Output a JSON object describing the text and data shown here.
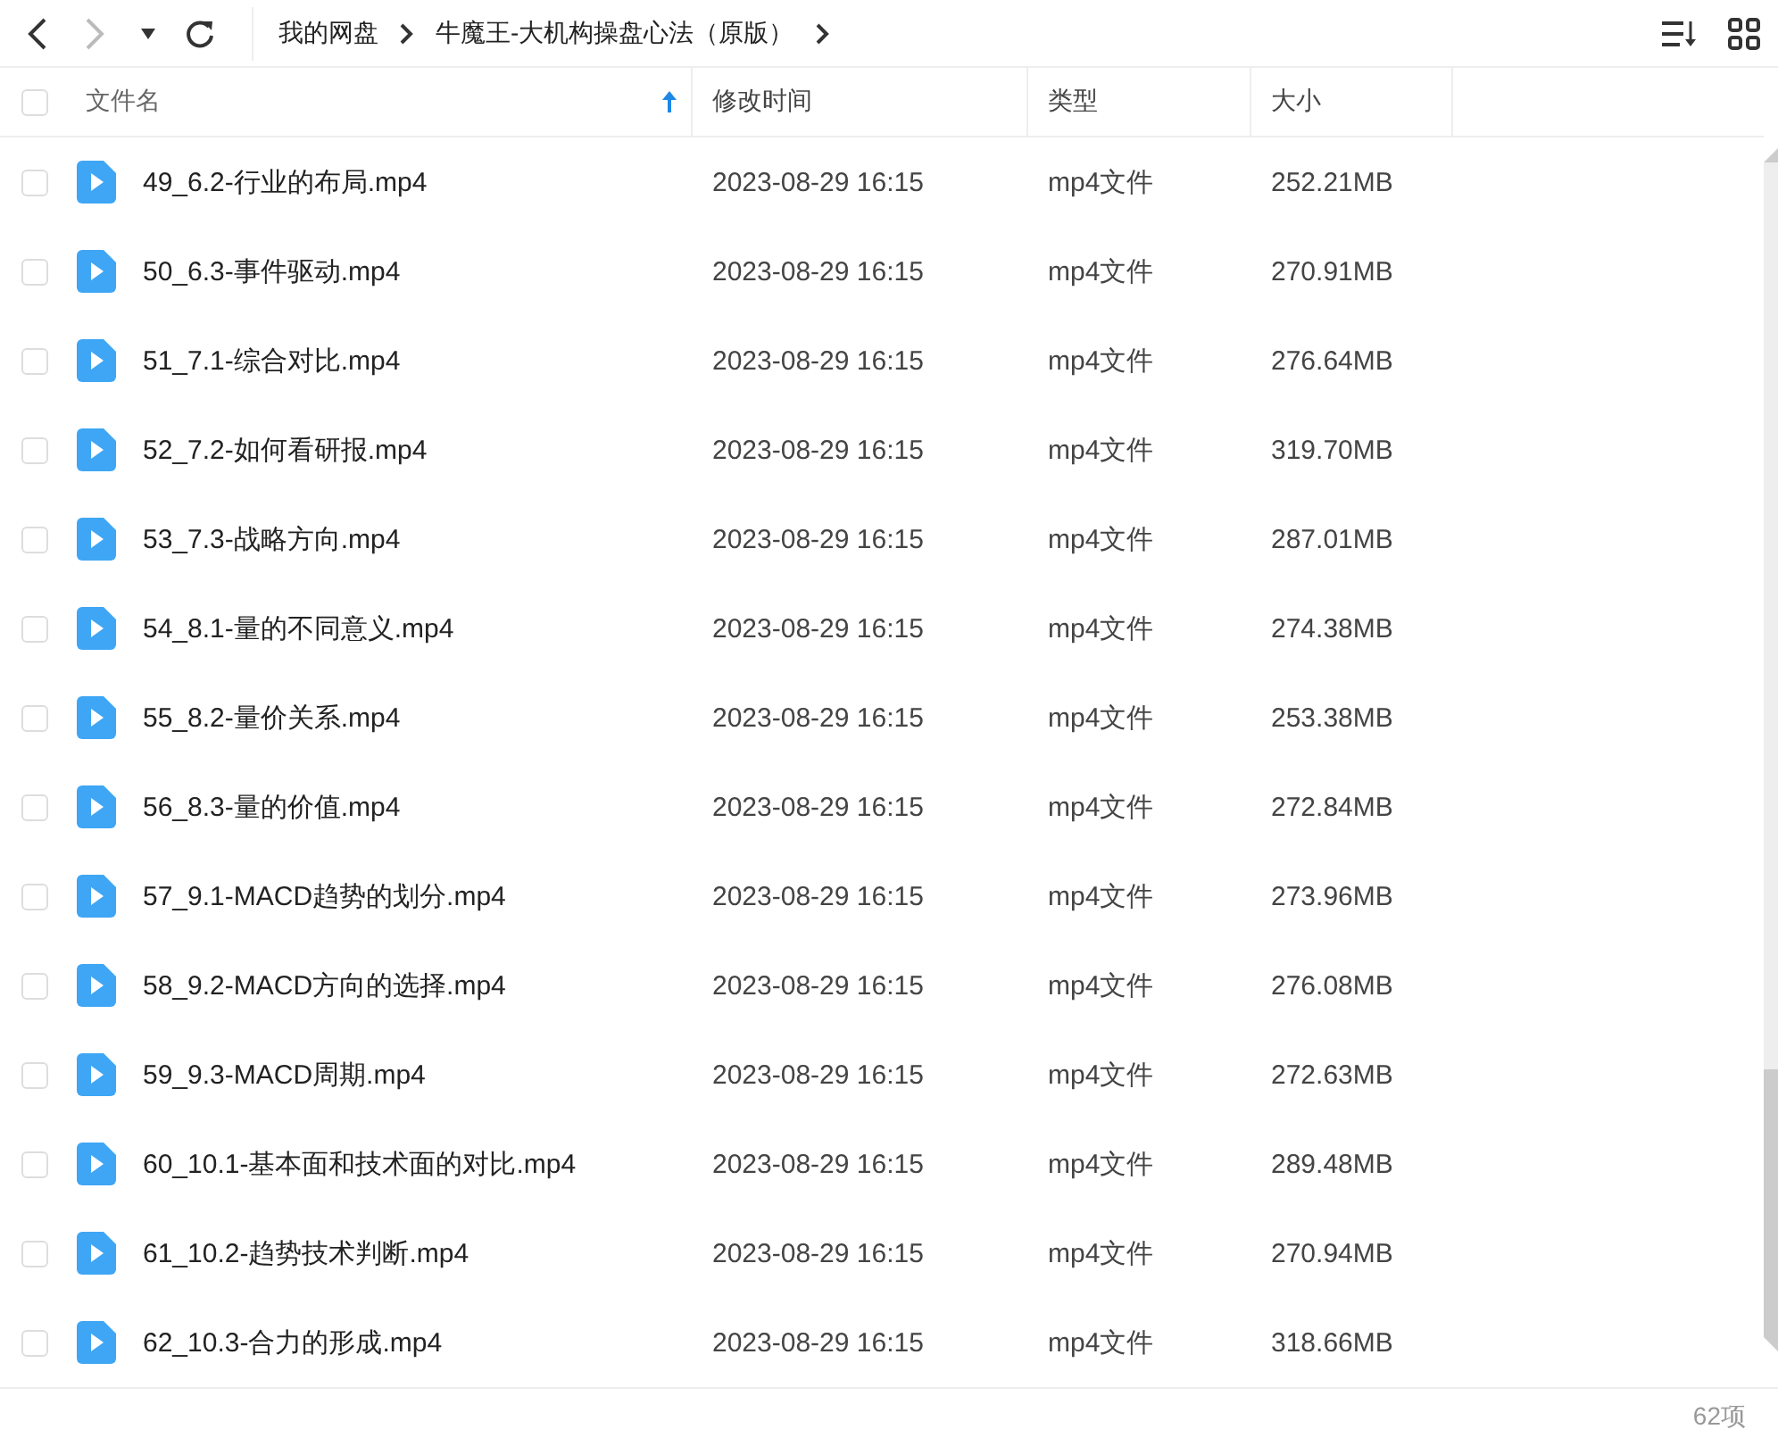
{
  "toolbar": {
    "breadcrumb": [
      "我的网盘",
      "牛魔王-大机构操盘心法（原版）"
    ]
  },
  "table": {
    "all_checked": false,
    "columns": [
      {
        "label": "文件名",
        "sorted": true
      },
      {
        "label": "修改时间",
        "sorted": false
      },
      {
        "label": "类型",
        "sorted": false
      },
      {
        "label": "大小",
        "sorted": false
      }
    ],
    "rows": [
      {
        "name": "49_6.2-行业的布局.mp4",
        "modified": "2023-08-29 16:15",
        "type": "mp4文件",
        "size": "252.21MB",
        "checked": false
      },
      {
        "name": "50_6.3-事件驱动.mp4",
        "modified": "2023-08-29 16:15",
        "type": "mp4文件",
        "size": "270.91MB",
        "checked": false
      },
      {
        "name": "51_7.1-综合对比.mp4",
        "modified": "2023-08-29 16:15",
        "type": "mp4文件",
        "size": "276.64MB",
        "checked": false
      },
      {
        "name": "52_7.2-如何看研报.mp4",
        "modified": "2023-08-29 16:15",
        "type": "mp4文件",
        "size": "319.70MB",
        "checked": false
      },
      {
        "name": "53_7.3-战略方向.mp4",
        "modified": "2023-08-29 16:15",
        "type": "mp4文件",
        "size": "287.01MB",
        "checked": false
      },
      {
        "name": "54_8.1-量的不同意义.mp4",
        "modified": "2023-08-29 16:15",
        "type": "mp4文件",
        "size": "274.38MB",
        "checked": false
      },
      {
        "name": "55_8.2-量价关系.mp4",
        "modified": "2023-08-29 16:15",
        "type": "mp4文件",
        "size": "253.38MB",
        "checked": false
      },
      {
        "name": "56_8.3-量的价值.mp4",
        "modified": "2023-08-29 16:15",
        "type": "mp4文件",
        "size": "272.84MB",
        "checked": false
      },
      {
        "name": "57_9.1-MACD趋势的划分.mp4",
        "modified": "2023-08-29 16:15",
        "type": "mp4文件",
        "size": "273.96MB",
        "checked": false
      },
      {
        "name": "58_9.2-MACD方向的选择.mp4",
        "modified": "2023-08-29 16:15",
        "type": "mp4文件",
        "size": "276.08MB",
        "checked": false
      },
      {
        "name": "59_9.3-MACD周期.mp4",
        "modified": "2023-08-29 16:15",
        "type": "mp4文件",
        "size": "272.63MB",
        "checked": false
      },
      {
        "name": "60_10.1-基本面和技术面的对比.mp4",
        "modified": "2023-08-29 16:15",
        "type": "mp4文件",
        "size": "289.48MB",
        "checked": false
      },
      {
        "name": "61_10.2-趋势技术判断.mp4",
        "modified": "2023-08-29 16:15",
        "type": "mp4文件",
        "size": "270.94MB",
        "checked": false
      },
      {
        "name": "62_10.3-合力的形成.mp4",
        "modified": "2023-08-29 16:15",
        "type": "mp4文件",
        "size": "318.66MB",
        "checked": false
      }
    ]
  },
  "status_bar": {
    "count": "62项"
  }
}
